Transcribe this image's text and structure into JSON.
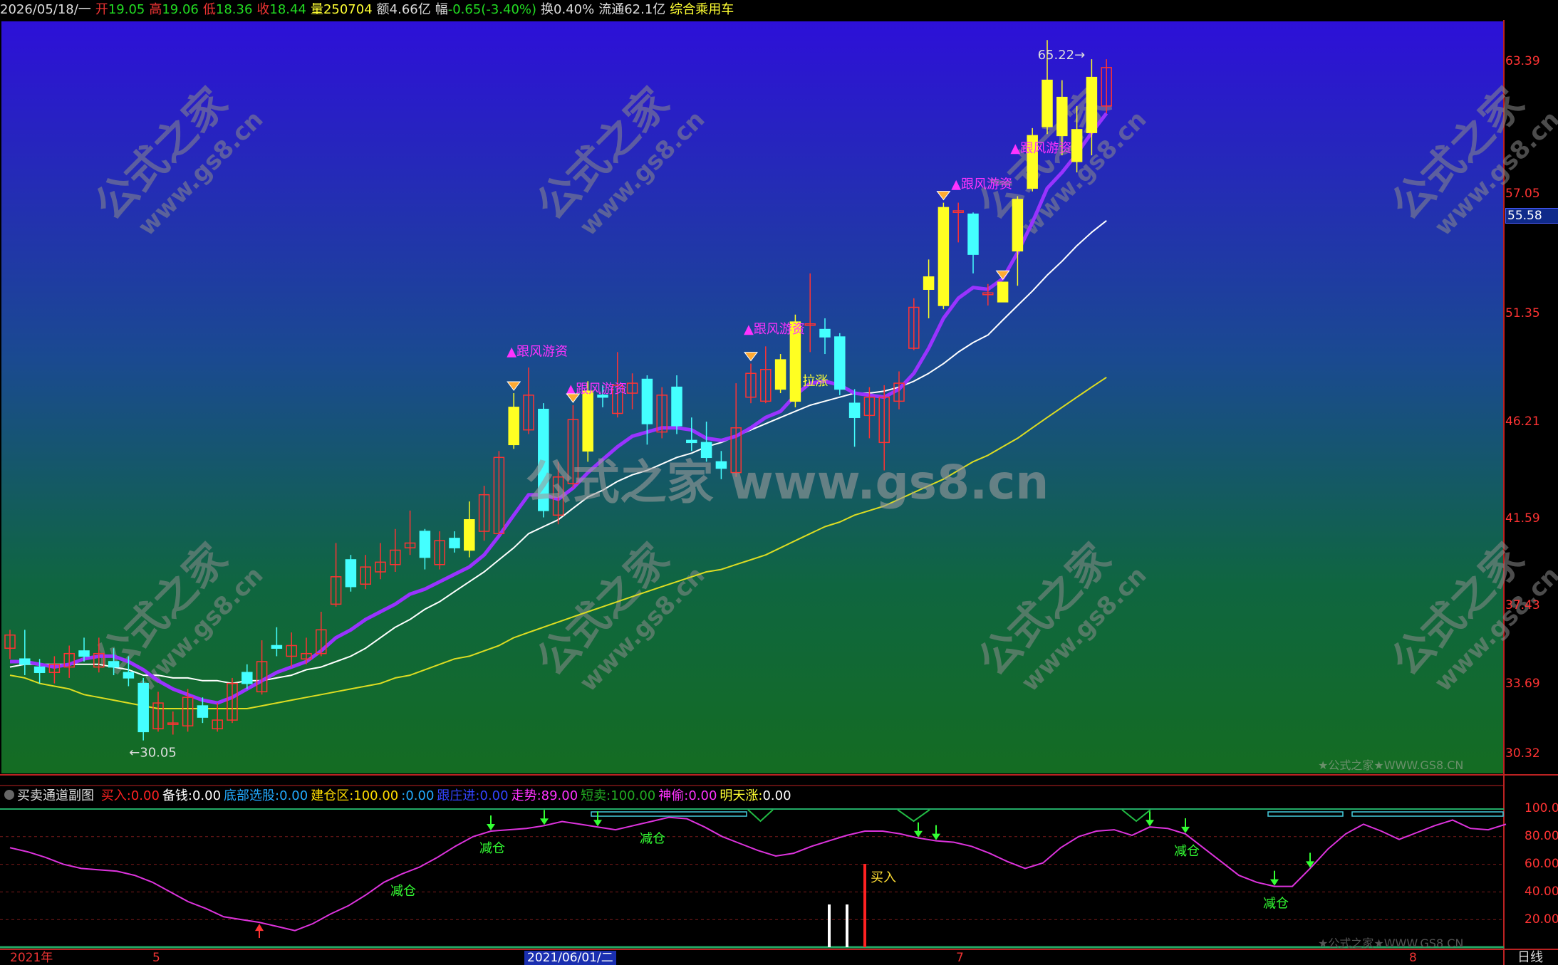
{
  "quote_bar": {
    "date": "2026/05/18/一",
    "open_label": "开",
    "open": "19.05",
    "high_label": "高",
    "high": "19.06",
    "low_label": "低",
    "low": "18.36",
    "close_label": "收",
    "close": "18.44",
    "volume_label": "量",
    "volume": "250704",
    "amount_label": "额",
    "amount": "4.66亿",
    "change_label": "幅",
    "change": "-0.65(-3.40%)",
    "turnover_label": "换",
    "turnover": "0.40%",
    "float_label": "流通",
    "float": "62.1亿",
    "sector": "综合乘用车"
  },
  "price_axis": {
    "ticks": [
      "63.39",
      "57.05",
      "51.35",
      "46.21",
      "41.59",
      "37.43",
      "33.69",
      "30.32"
    ],
    "current_price": "55.58"
  },
  "indicator_header": {
    "name": "买卖通道副图",
    "fields": [
      {
        "label": "买入:",
        "value": "0.00",
        "color": "#ff2222"
      },
      {
        "label": "备钱:",
        "value": "0.00",
        "color": "#ffffff"
      },
      {
        "label": "底部选股:",
        "value": "0.00",
        "color": "#22aaff"
      },
      {
        "label": "建仓区:",
        "value": "100.00",
        "color": "#ffdd00"
      },
      {
        "label": ":",
        "value": "0.00",
        "color": "#22aaff"
      },
      {
        "label": "跟庄进:",
        "value": "0.00",
        "color": "#3344ff"
      },
      {
        "label": "走势:",
        "value": "89.00",
        "color": "#ff33ff"
      },
      {
        "label": "短卖:",
        "value": "100.00",
        "color": "#22aa22"
      },
      {
        "label": "神偷:",
        "value": "0.00",
        "color": "#ff33ff"
      },
      {
        "label": "明天涨:",
        "value": "0.00",
        "color": "#ffff33"
      }
    ]
  },
  "osc_axis": {
    "ticks": [
      "100.00",
      "80.00",
      "60.00",
      "40.00",
      "20.00"
    ]
  },
  "time_axis": {
    "labels": [
      "2021年",
      "5",
      "7",
      "8"
    ],
    "current": "2021/06/01/二",
    "period": "日线"
  },
  "watermark": {
    "main": "公式之家 www.gs8.cn",
    "diag_cn": "公式之家",
    "diag_en": "www.gs8.cn",
    "footer": "★公式之家★WWW.GS8.CN"
  },
  "colors": {
    "up_candle": "#ff3333",
    "down_candle": "#44ffff",
    "highlight_candle": "#ffff22",
    "ma_fast": "#9933ff",
    "ma_mid": "#ffffff",
    "ma_slow": "#dddd22",
    "osc_line": "#dd33dd",
    "signal_text": "#ff33ff",
    "reduce_text": "#33ff33"
  },
  "chart_data": [
    {
      "type": "candlestick",
      "title": "",
      "y_scale": "log",
      "ylim": [
        29.5,
        68.0
      ],
      "candles": [
        [
          33.9,
          34.4,
          34.6,
          33.5
        ],
        [
          33.5,
          33.3,
          34.6,
          32.9
        ],
        [
          33.2,
          33.0,
          33.5,
          32.6
        ],
        [
          33.0,
          33.3,
          33.6,
          32.6
        ],
        [
          33.2,
          33.7,
          34.0,
          32.8
        ],
        [
          33.8,
          33.6,
          34.3,
          33.4
        ],
        [
          33.2,
          33.7,
          34.3,
          33.0
        ],
        [
          33.4,
          33.2,
          33.9,
          32.9
        ],
        [
          33.0,
          32.8,
          33.6,
          32.5
        ],
        [
          32.6,
          30.9,
          32.8,
          30.6
        ],
        [
          31.0,
          31.9,
          32.3,
          30.9
        ],
        [
          31.2,
          31.2,
          31.6,
          30.8
        ],
        [
          31.1,
          32.1,
          32.4,
          30.9
        ],
        [
          31.8,
          31.4,
          32.1,
          31.2
        ],
        [
          31.0,
          31.3,
          31.9,
          30.9
        ],
        [
          31.3,
          32.6,
          32.8,
          31.2
        ],
        [
          33.0,
          32.6,
          33.3,
          32.4
        ],
        [
          32.3,
          33.4,
          34.2,
          32.2
        ],
        [
          34.0,
          33.9,
          34.7,
          33.6
        ],
        [
          33.6,
          34.0,
          34.5,
          33.2
        ],
        [
          33.5,
          33.7,
          34.3,
          33.3
        ],
        [
          33.7,
          34.6,
          35.3,
          33.6
        ],
        [
          35.6,
          36.7,
          38.1,
          35.5
        ],
        [
          37.4,
          36.3,
          37.6,
          36.1
        ],
        [
          36.4,
          37.1,
          37.6,
          36.2
        ],
        [
          36.9,
          37.3,
          38.1,
          36.6
        ],
        [
          37.2,
          37.8,
          38.7,
          36.9
        ],
        [
          37.9,
          38.1,
          39.5,
          37.6
        ],
        [
          38.6,
          37.5,
          38.7,
          37.0
        ],
        [
          37.2,
          38.2,
          38.6,
          37.0
        ],
        [
          38.3,
          37.9,
          38.6,
          37.7
        ],
        [
          37.8,
          39.1,
          39.9,
          37.5
        ],
        [
          38.6,
          40.2,
          40.6,
          38.2
        ],
        [
          38.5,
          41.9,
          42.2,
          38.5
        ],
        [
          42.5,
          44.3,
          45.0,
          42.3
        ],
        [
          43.2,
          44.9,
          46.3,
          43.0
        ],
        [
          44.2,
          39.5,
          44.5,
          39.2
        ],
        [
          39.3,
          41.0,
          41.7,
          38.9
        ],
        [
          40.7,
          43.7,
          44.4,
          40.5
        ],
        [
          42.2,
          45.1,
          45.6,
          41.7
        ],
        [
          44.9,
          44.8,
          45.4,
          44.3
        ],
        [
          44.0,
          45.4,
          47.1,
          43.8
        ],
        [
          45.0,
          45.5,
          46.0,
          44.2
        ],
        [
          45.7,
          43.5,
          45.9,
          42.5
        ],
        [
          43.1,
          44.9,
          45.3,
          42.8
        ],
        [
          45.3,
          43.4,
          45.9,
          43.0
        ],
        [
          42.7,
          42.6,
          43.8,
          42.2
        ],
        [
          42.6,
          41.9,
          43.6,
          41.7
        ],
        [
          41.7,
          41.4,
          42.2,
          40.9
        ],
        [
          41.2,
          43.3,
          45.5,
          41.0
        ],
        [
          44.8,
          46.0,
          46.5,
          44.5
        ],
        [
          44.6,
          46.2,
          47.4,
          44.5
        ],
        [
          46.7,
          45.2,
          47.0,
          45.0
        ],
        [
          44.6,
          48.7,
          49.1,
          44.3
        ],
        [
          48.6,
          48.6,
          51.4,
          47.1
        ],
        [
          48.3,
          47.9,
          48.9,
          47.0
        ],
        [
          47.9,
          45.2,
          48.1,
          44.9
        ],
        [
          44.5,
          43.8,
          45.2,
          42.4
        ],
        [
          43.9,
          44.8,
          45.3,
          42.8
        ],
        [
          42.6,
          44.8,
          45.4,
          41.3
        ],
        [
          44.6,
          45.5,
          46.1,
          44.2
        ],
        [
          47.3,
          49.5,
          50.0,
          47.2
        ],
        [
          50.5,
          51.2,
          52.2,
          48.9
        ],
        [
          49.6,
          55.3,
          55.6,
          49.4
        ],
        [
          55.0,
          55.1,
          55.6,
          53.2
        ],
        [
          54.9,
          52.5,
          55.0,
          51.4
        ],
        [
          50.2,
          50.3,
          50.8,
          49.6
        ],
        [
          49.8,
          50.9,
          50.9,
          49.8
        ],
        [
          52.7,
          55.8,
          56.0,
          50.7
        ],
        [
          56.5,
          59.9,
          60.4,
          56.3
        ],
        [
          60.5,
          63.7,
          66.6,
          60.0
        ],
        [
          62.5,
          59.9,
          63.7,
          58.6
        ],
        [
          58.2,
          60.3,
          61.9,
          57.5
        ],
        [
          60.1,
          63.9,
          65.2,
          58.6
        ],
        [
          61.9,
          64.6,
          65.2,
          61.4
        ]
      ],
      "highlighted": [
        31,
        34,
        39,
        52,
        53,
        62,
        63,
        67,
        68,
        69,
        70,
        71,
        72,
        73
      ],
      "series": [
        {
          "name": "",
          "values": [
            33.4,
            33.4,
            33.3,
            33.2,
            33.3,
            33.5,
            33.6,
            33.6,
            33.4,
            33.1,
            32.7,
            32.4,
            32.2,
            32.0,
            31.9,
            32.1,
            32.4,
            32.7,
            33.0,
            33.2,
            33.4,
            33.8,
            34.3,
            34.6,
            35.0,
            35.3,
            35.6,
            36.0,
            36.2,
            36.5,
            36.8,
            37.1,
            37.6,
            38.4,
            39.3,
            40.2,
            40.2,
            40.0,
            40.5,
            41.2,
            41.8,
            42.4,
            42.9,
            43.1,
            43.3,
            43.3,
            43.2,
            42.8,
            42.7,
            42.9,
            43.3,
            43.8,
            44.1,
            44.9,
            45.5,
            45.6,
            45.4,
            45.0,
            44.9,
            44.8,
            45.2,
            46.0,
            47.3,
            48.9,
            50.0,
            50.6,
            50.5,
            51.1,
            52.6,
            54.4,
            56.5,
            57.5,
            58.7,
            60.1,
            61.4
          ]
        },
        {
          "name": "",
          "values": [
            33.2,
            33.3,
            33.3,
            33.3,
            33.3,
            33.3,
            33.3,
            33.2,
            33.1,
            32.9,
            32.9,
            32.8,
            32.8,
            32.7,
            32.7,
            32.6,
            32.7,
            32.7,
            32.8,
            32.9,
            33.1,
            33.2,
            33.4,
            33.6,
            33.9,
            34.3,
            34.7,
            35.0,
            35.4,
            35.7,
            36.1,
            36.5,
            36.9,
            37.4,
            37.9,
            38.5,
            38.8,
            39.1,
            39.6,
            40.1,
            40.4,
            40.8,
            41.1,
            41.3,
            41.6,
            41.9,
            42.1,
            42.4,
            42.6,
            42.9,
            43.2,
            43.5,
            43.8,
            44.1,
            44.4,
            44.6,
            44.8,
            45.0,
            45.0,
            45.1,
            45.3,
            45.6,
            46.0,
            46.5,
            47.1,
            47.6,
            48.0,
            48.8,
            49.6,
            50.4,
            51.3,
            52.1,
            53.0,
            53.8,
            54.5
          ]
        },
        {
          "name": "",
          "values": [
            32.9,
            32.8,
            32.6,
            32.5,
            32.4,
            32.2,
            32.1,
            32.0,
            31.9,
            31.8,
            31.7,
            31.7,
            31.7,
            31.7,
            31.7,
            31.7,
            31.7,
            31.8,
            31.9,
            32.0,
            32.1,
            32.2,
            32.3,
            32.4,
            32.5,
            32.6,
            32.8,
            32.9,
            33.1,
            33.3,
            33.5,
            33.6,
            33.8,
            34.0,
            34.3,
            34.5,
            34.7,
            34.9,
            35.1,
            35.3,
            35.5,
            35.7,
            35.9,
            36.1,
            36.3,
            36.5,
            36.7,
            36.9,
            37.0,
            37.2,
            37.4,
            37.6,
            37.9,
            38.2,
            38.5,
            38.8,
            39.0,
            39.3,
            39.5,
            39.7,
            40.0,
            40.3,
            40.6,
            40.9,
            41.3,
            41.7,
            42.0,
            42.4,
            42.8,
            43.3,
            43.8,
            44.3,
            44.8,
            45.3,
            45.8
          ]
        }
      ],
      "annotations": [
        {
          "index": 9,
          "price": 30.05,
          "text": "←30.05",
          "kind": "low"
        },
        {
          "index": 72,
          "price": 65.22,
          "text": "65.22→",
          "kind": "high"
        },
        {
          "index": 34,
          "price": 46.9,
          "text": "▲跟风游资",
          "kind": "signal"
        },
        {
          "index": 38,
          "price": 45.0,
          "text": "▲跟风游资",
          "kind": "signal"
        },
        {
          "index": 50,
          "price": 48.1,
          "text": "▲跟风游资",
          "kind": "signal"
        },
        {
          "index": 64,
          "price": 56.5,
          "text": "▲跟风游资",
          "kind": "signal"
        },
        {
          "index": 68,
          "price": 58.8,
          "text": "▲跟风游资",
          "kind": "signal"
        },
        {
          "index": 53,
          "price": 45.4,
          "text": "拉涨",
          "kind": "pull"
        }
      ],
      "diamonds": [
        34,
        38,
        50,
        63,
        67
      ]
    },
    {
      "type": "line",
      "title": "买卖通道副图",
      "ylim": [
        0,
        100
      ],
      "y_ticks": [
        100,
        80,
        60,
        40,
        20
      ],
      "series": [
        {
          "name": "走势",
          "values": [
            72,
            69,
            65,
            60,
            57,
            56,
            55,
            52,
            47,
            40,
            33,
            28,
            22,
            20,
            18,
            15,
            12,
            17,
            24,
            30,
            38,
            47,
            53,
            58,
            65,
            73,
            80,
            84,
            85,
            86,
            88,
            91,
            89,
            87,
            85,
            88,
            91,
            94,
            93,
            87,
            80,
            75,
            70,
            66,
            68,
            73,
            77,
            81,
            84,
            84,
            82,
            79,
            77,
            76,
            73,
            68,
            62,
            57,
            61,
            72,
            80,
            84,
            85,
            81,
            87,
            86,
            82,
            72,
            62,
            52,
            47,
            44,
            44,
            57,
            71,
            82,
            89,
            84,
            78,
            83,
            88,
            92,
            86,
            85,
            89
          ]
        }
      ],
      "buy_signal": {
        "index": 46,
        "text": "买入"
      },
      "reduce_labels": [
        {
          "index": 22,
          "text": "减仓"
        },
        {
          "index": 27,
          "text": "减仓"
        },
        {
          "index": 36,
          "text": "减仓"
        },
        {
          "index": 66,
          "text": "减仓"
        },
        {
          "index": 71,
          "text": "减仓"
        }
      ],
      "green_down_arrows": [
        27,
        30,
        33,
        51,
        52,
        64,
        66,
        71,
        73
      ],
      "red_up_arrow": 14,
      "white_bars": [
        46,
        47
      ],
      "red_bar": 48
    }
  ]
}
